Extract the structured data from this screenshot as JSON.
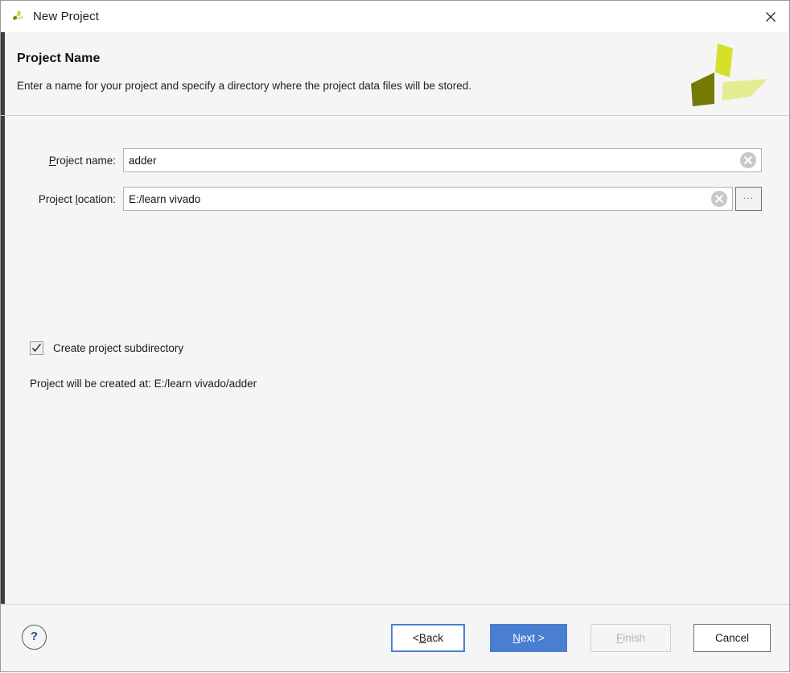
{
  "window": {
    "title": "New Project",
    "app_icon": "vivado-logo-icon",
    "close_icon": "close-icon"
  },
  "header": {
    "title": "Project Name",
    "subtitle": "Enter a name for your project and specify a directory where the project data files will be stored.",
    "logo_icon": "xilinx-pinwheel-logo",
    "accent_color": "#3d3d3d",
    "logo_colors": {
      "top": "#d4e02a",
      "left": "#737a05",
      "right": "#e4ec92"
    }
  },
  "form": {
    "project_name": {
      "label_before": "P",
      "label_mnemonic": "P",
      "label_full": "Project name:",
      "label_pre": "",
      "label_post": "roject name:",
      "value": "adder",
      "clear_icon": "clear-circle-icon"
    },
    "project_location": {
      "label_full": "Project location:",
      "label_pre": "Project ",
      "label_mnemonic": "l",
      "label_post": "ocation:",
      "value": "E:/learn vivado",
      "clear_icon": "clear-circle-icon",
      "browse_label": "...",
      "browse_icon": "ellipsis-icon"
    },
    "create_subdirectory": {
      "label": "Create project subdirectory",
      "checked": true,
      "check_icon": "checkmark-icon"
    },
    "status_text": "Project will be created at: E:/learn vivado/adder"
  },
  "footer": {
    "help": {
      "glyph": "?",
      "icon": "help-question-icon"
    },
    "buttons": {
      "back": {
        "pre": "< ",
        "mnemonic": "B",
        "post": "ack",
        "label": "< Back",
        "state": "focused"
      },
      "next": {
        "pre": "",
        "mnemonic": "N",
        "post": "ext >",
        "label": "Next >",
        "state": "default"
      },
      "finish": {
        "pre": "",
        "mnemonic": "F",
        "post": "inish",
        "label": "Finish",
        "state": "disabled"
      },
      "cancel": {
        "pre": "",
        "mnemonic": "",
        "post": "Cancel",
        "label": "Cancel",
        "state": "normal"
      }
    },
    "accent_color": "#4a7ed0"
  }
}
